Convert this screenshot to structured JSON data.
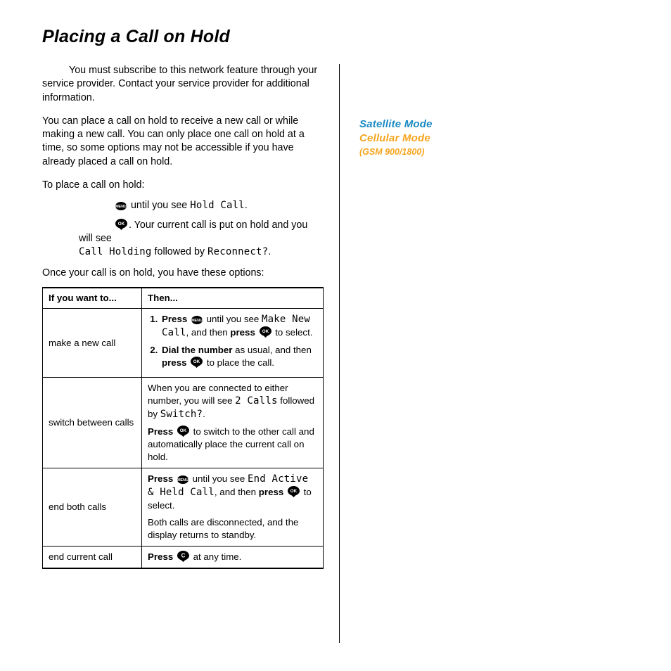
{
  "title": "Placing a Call on Hold",
  "intro": "You must subscribe to this network feature through your service provider. Contact your service provider for additional information.",
  "body1": "You can place a call on hold to receive a new call or while making a new call. You can only place one call on hold at a time, so some options may not be accessible if you have already placed a call on hold.",
  "prompt": "To place a call on hold:",
  "step1_tail": " until you see ",
  "lcd_hold_call": "Hold Call",
  "step2_mid": ". Your current call is put on hold and you will see ",
  "lcd_call_holding": "Call Holding",
  "step2_followed": " followed by ",
  "lcd_reconnect": "Reconnect?",
  "options_intro": "Once your call is on hold, you have these options:",
  "table": {
    "h1": "If you want to...",
    "h2": "Then...",
    "rows": [
      {
        "want": "make a new call",
        "s1_a": "Press ",
        "s1_b": " until you see ",
        "s1_lcd": "Make New Call",
        "s1_c": ", and then ",
        "s1_d": "press ",
        "s1_e": " to select.",
        "s2_a": "Dial the number",
        "s2_b": " as usual, and then ",
        "s2_c": "press ",
        "s2_d": " to place the call."
      },
      {
        "want": "switch between calls",
        "p1_a": "When you are connected to either number, you will see ",
        "p1_lcd1": "2 Calls",
        "p1_b": " followed by ",
        "p1_lcd2": "Switch?",
        "p1_c": ".",
        "p2_a": "Press ",
        "p2_b": " to switch to the other call and automatically place the current call on hold."
      },
      {
        "want": "end both calls",
        "p1_a": "Press ",
        "p1_b": " until you see ",
        "p1_lcd": "End Active & Held Call",
        "p1_c": ", and then ",
        "p1_d": "press ",
        "p1_e": " to select.",
        "p2": "Both calls are disconnected, and the display returns to standby."
      },
      {
        "want": "end current call",
        "p1_a": "Press ",
        "p1_b": " at any time."
      }
    ]
  },
  "sidebar": {
    "satellite": "Satellite Mode",
    "cellular": "Cellular Mode",
    "gsm": "(GSM 900/1800)"
  },
  "period": "."
}
